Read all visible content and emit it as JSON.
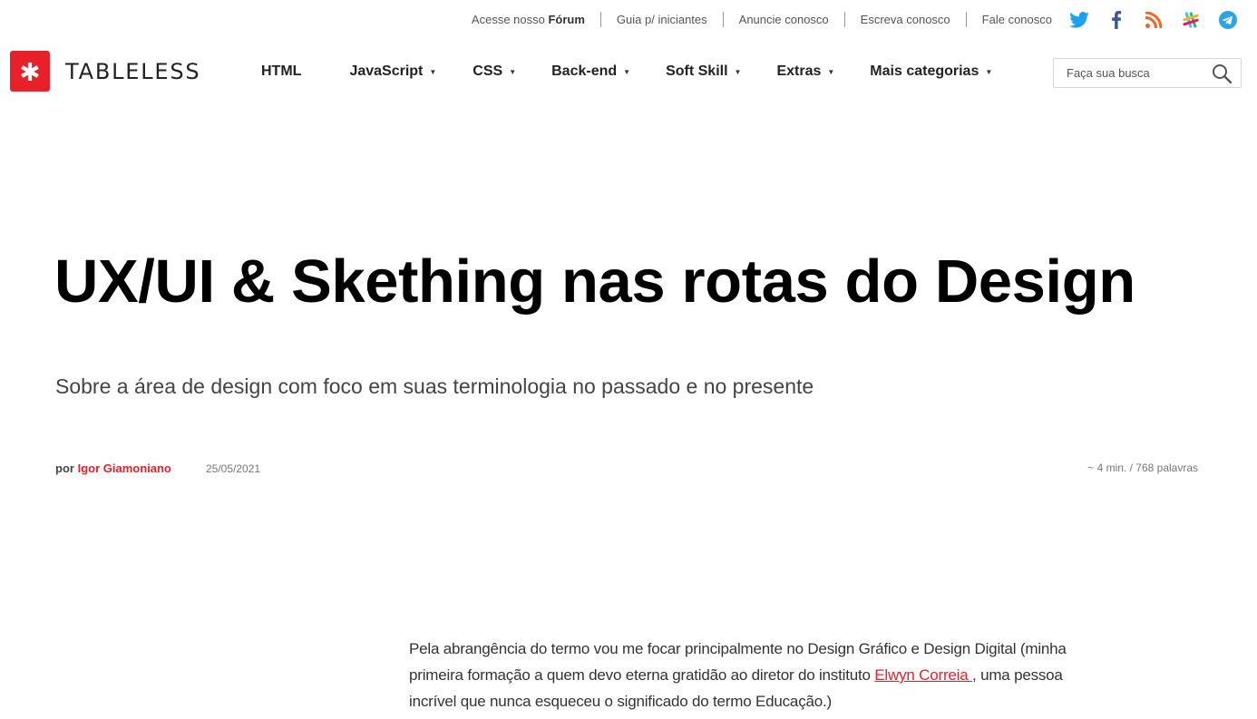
{
  "topbar": {
    "links": [
      {
        "prefix": "Acesse nosso ",
        "strong": "Fórum"
      },
      {
        "label": "Guia p/ iniciantes"
      },
      {
        "label": "Anuncie conosco"
      },
      {
        "label": "Escreva conosco"
      },
      {
        "label": "Fale conosco"
      }
    ],
    "social_icons": [
      "twitter-icon",
      "facebook-icon",
      "rss-icon",
      "slack-icon",
      "telegram-icon"
    ]
  },
  "header": {
    "logo_text": "TABLELESS",
    "nav": [
      {
        "label": "HTML",
        "has_dropdown": false
      },
      {
        "label": "JavaScript",
        "has_dropdown": true
      },
      {
        "label": "CSS",
        "has_dropdown": true
      },
      {
        "label": "Back-end",
        "has_dropdown": true
      },
      {
        "label": "Soft Skill",
        "has_dropdown": true
      },
      {
        "label": "Extras",
        "has_dropdown": true
      },
      {
        "label": "Mais categorias",
        "has_dropdown": true
      }
    ],
    "search_placeholder": "Faça sua busca"
  },
  "article": {
    "title": "UX/UI & Skething nas rotas do Design",
    "subtitle": "Sobre a área de design com foco em suas terminologia no passado e no presente",
    "by": "por",
    "author": "Igor Giamoniano",
    "date": "25/05/2021",
    "reading": "~ 4 min. / 768 palavras",
    "body_before_link": "Pela abrangência do termo vou me focar principalmente no Design Gráfico e Design Digital (minha primeira formação a quem devo eterna gratidão ao diretor do instituto ",
    "body_link": "Elwyn Correia ",
    "body_after_link": ", uma pessoa incrível que nunca esqueceu o significado do termo Educação.)"
  },
  "colors": {
    "brand": "#e8202a",
    "twitter": "#1da1f2",
    "facebook": "#3b5998",
    "rss": "#f26522",
    "telegram": "#2ca5e0"
  }
}
